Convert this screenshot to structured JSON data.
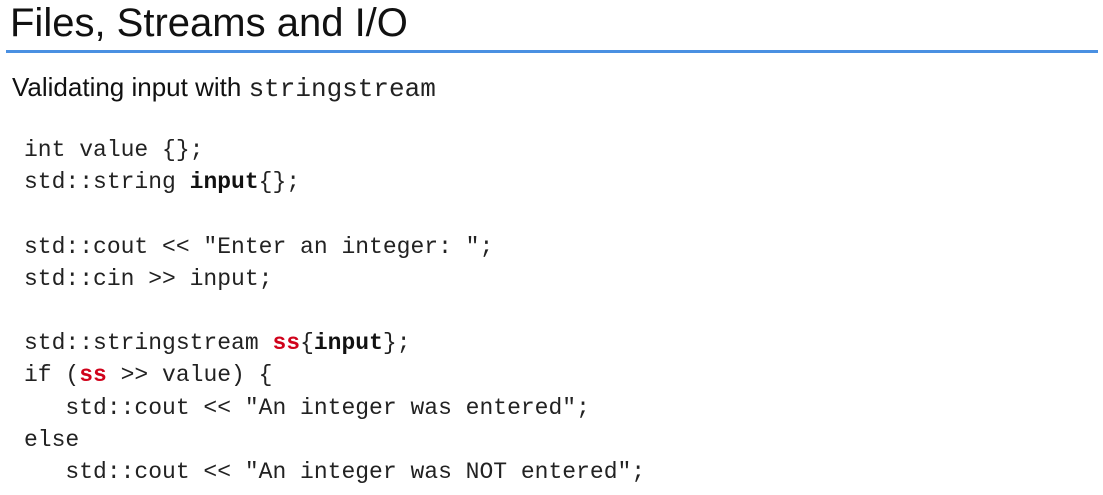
{
  "title": "Files, Streams and I/O",
  "subtitle": {
    "text": "Validating input with ",
    "code": "stringstream"
  },
  "code": {
    "line1": "int value {};",
    "line2_pre": "std::string ",
    "line2_bold": "input",
    "line2_post": "{};",
    "line3": "std::cout << \"Enter an integer: \";",
    "line4": "std::cin >> input;",
    "line5_pre": "std::stringstream ",
    "line5_red": "ss",
    "line5_mid": "{",
    "line5_bold": "input",
    "line5_post": "};",
    "line6_pre": "if (",
    "line6_red": "ss",
    "line6_post": " >> value) {",
    "line7": "   std::cout << \"An integer was entered\";",
    "line8": "else",
    "line9": "   std::cout << \"An integer was NOT entered\";"
  },
  "colors": {
    "accent_rule": "#4a90e2",
    "highlight_red": "#d0021b"
  }
}
